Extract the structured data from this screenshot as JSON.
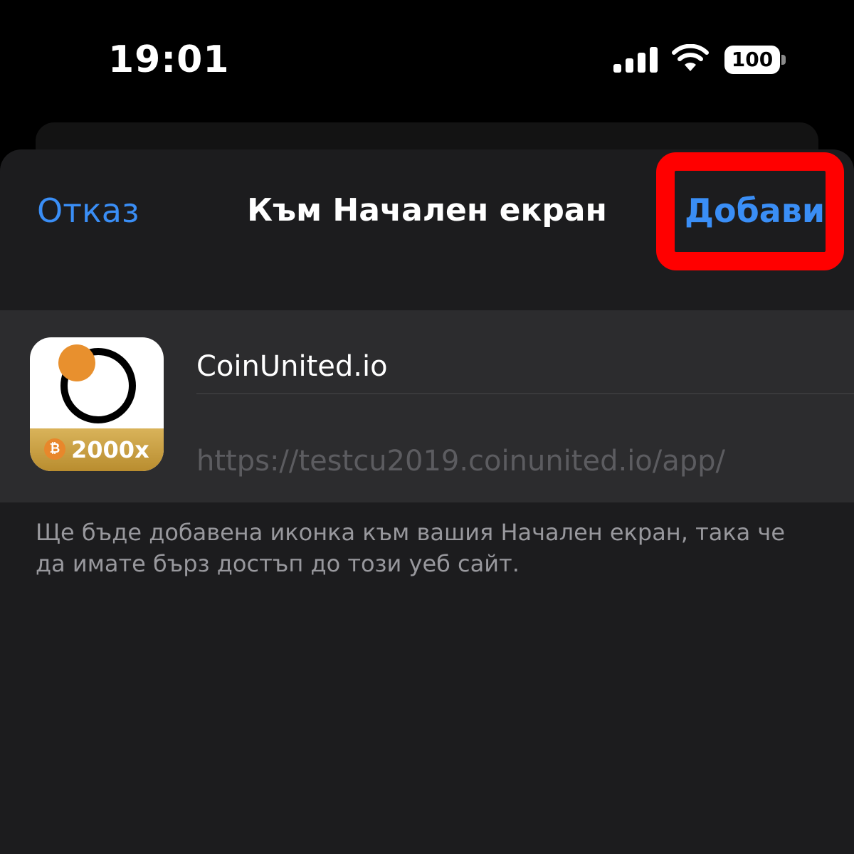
{
  "status_bar": {
    "time": "19:01",
    "battery_level": "100"
  },
  "nav": {
    "cancel_label": "Отказ",
    "title": "Към Начален екран",
    "add_label": "Добави"
  },
  "app": {
    "name": "CoinUnited.io",
    "url": "https://testcu2019.coinunited.io/app/",
    "icon_badge": "2000x",
    "icon_badge_symbol": "₿"
  },
  "description": "Ще бъде добавена иконка към вашия Начален екран, така че да имате бърз достъп до този уеб сайт.",
  "colors": {
    "accent": "#3a8ef6",
    "highlight": "#ff0000",
    "sheet_bg": "#1c1c1e",
    "card_bg": "#2c2c2e",
    "icon_dot": "#e8902e",
    "icon_gold": "#c9a045"
  }
}
